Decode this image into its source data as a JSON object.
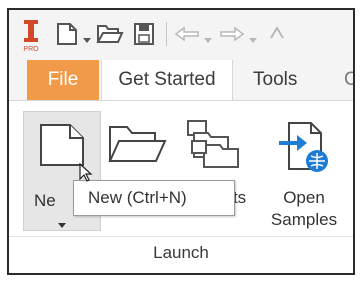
{
  "ribbon_tabs": {
    "file": "File",
    "get_started": "Get Started",
    "tools": "Tools",
    "cut_off": "C"
  },
  "ribbon": {
    "new_label_visible": "Ne",
    "projects_label_visible": "ects",
    "open_samples_line1": "Open",
    "open_samples_line2": "Samples",
    "panel_title": "Launch"
  },
  "tooltip": {
    "text": "New (Ctrl+N)"
  },
  "icons": {
    "app": "inventor-pro-icon",
    "new": "new-document-icon",
    "open": "open-folder-icon",
    "save": "save-icon",
    "undo": "undo-icon",
    "redo": "redo-icon",
    "projects": "projects-icon",
    "open_samples": "open-samples-icon"
  },
  "colors": {
    "file_tab": "#f19a4a",
    "accent_blue": "#1e7bd6"
  }
}
